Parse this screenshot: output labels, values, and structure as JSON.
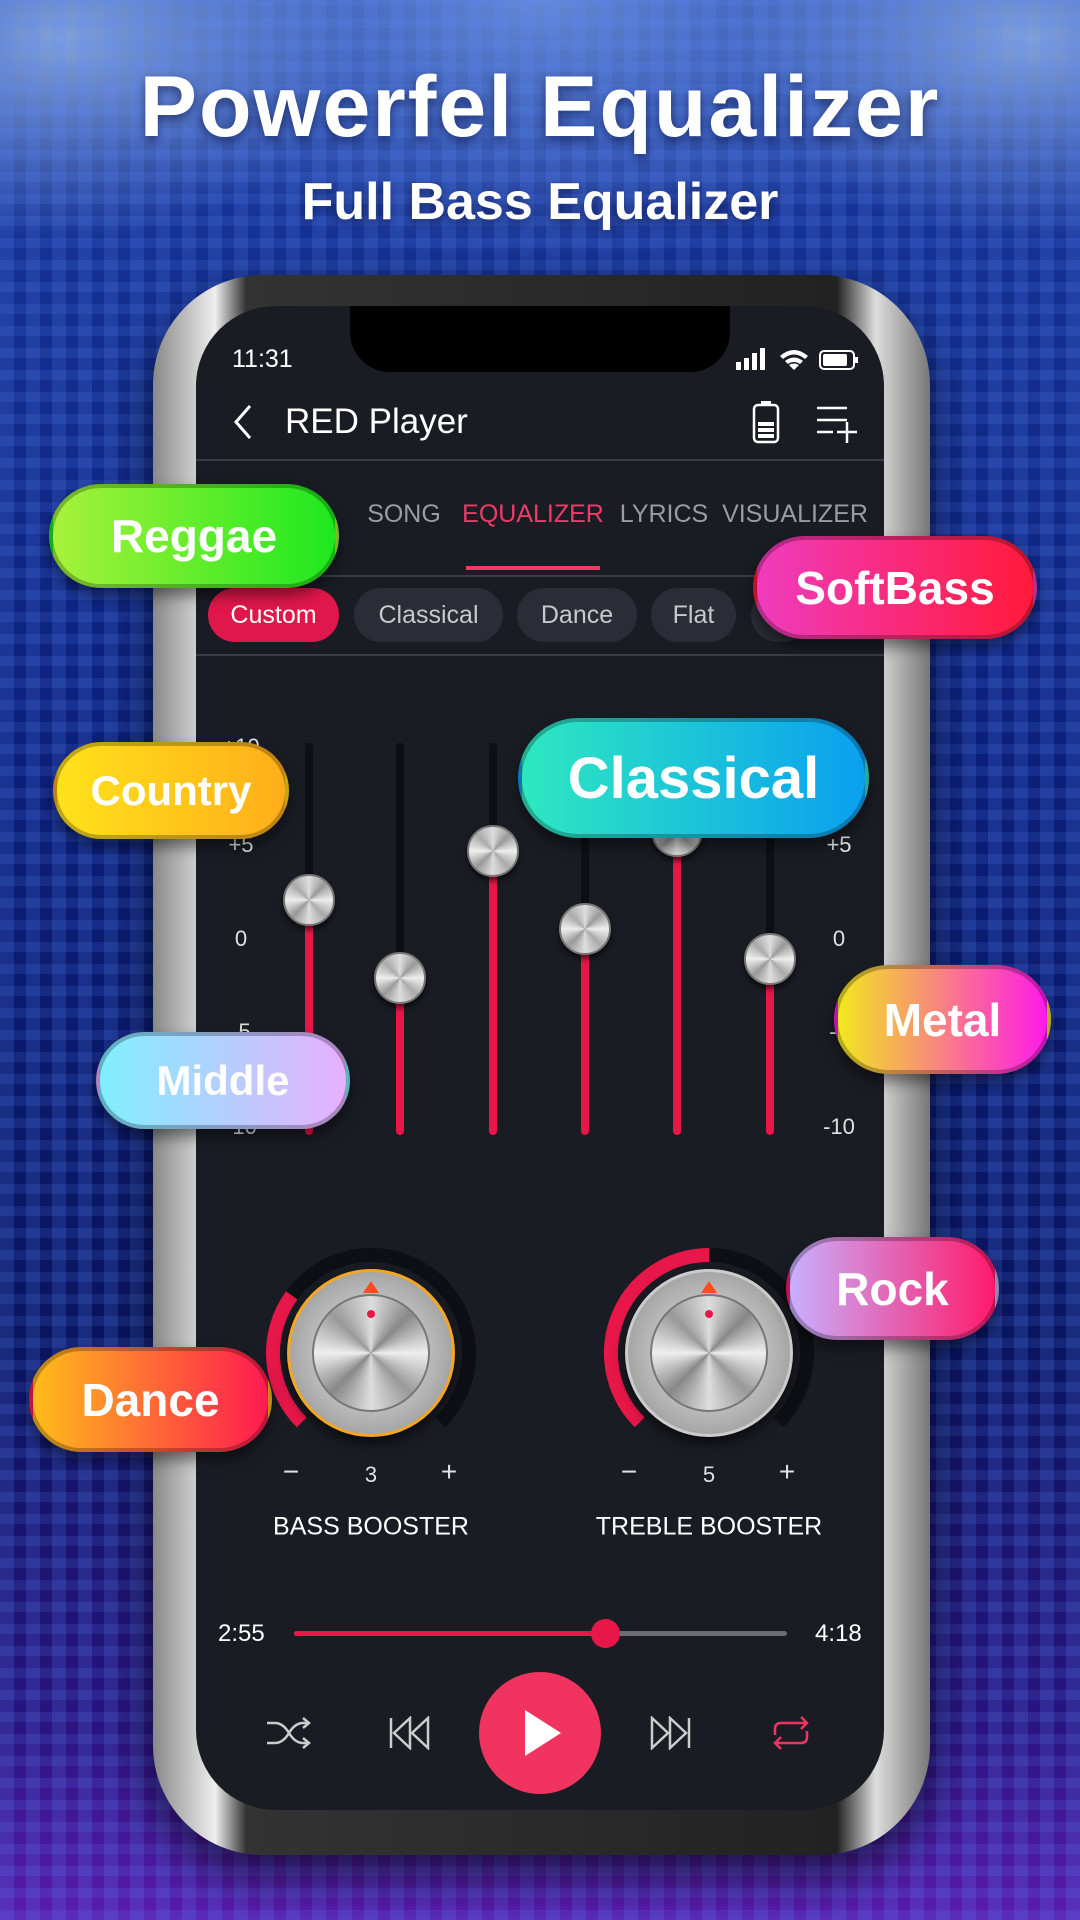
{
  "promo": {
    "title": "Powerfel Equalizer",
    "subtitle": "Full Bass Equalizer"
  },
  "status": {
    "time": "11:31"
  },
  "header": {
    "title": "RED Player",
    "back_icon": "chevron-left-icon",
    "icons": [
      "battery-icon",
      "playlist-add-icon"
    ]
  },
  "tabs": [
    {
      "label": "SONG",
      "active": false
    },
    {
      "label": "EQUALIZER",
      "active": true
    },
    {
      "label": "LYRICS",
      "active": false
    },
    {
      "label": "VISUALIZER",
      "active": false
    }
  ],
  "presets": [
    {
      "label": "Custom",
      "active": true
    },
    {
      "label": "Classical"
    },
    {
      "label": "Dance"
    },
    {
      "label": "Flat"
    }
  ],
  "equalizer": {
    "scale_labels": [
      "+10",
      "+5",
      "0",
      "-5",
      "-10"
    ],
    "range": [
      -10,
      10
    ],
    "bands": [
      2,
      -2,
      4.5,
      0.5,
      5.5,
      -1
    ]
  },
  "boosters": [
    {
      "label": "BASS BOOSTER",
      "value": "3",
      "minus": "−",
      "plus": "+"
    },
    {
      "label": "TREBLE BOOSTER",
      "value": "5",
      "minus": "−",
      "plus": "+"
    }
  ],
  "player": {
    "elapsed": "2:55",
    "total": "4:18",
    "progress": 0.63
  },
  "floating_labels": [
    "Reggae",
    "SoftBass",
    "Country",
    "Classical",
    "Metal",
    "Middle",
    "Rock",
    "Dance"
  ],
  "colors": {
    "accent": "#e8174a",
    "background": "#1a1c24"
  }
}
